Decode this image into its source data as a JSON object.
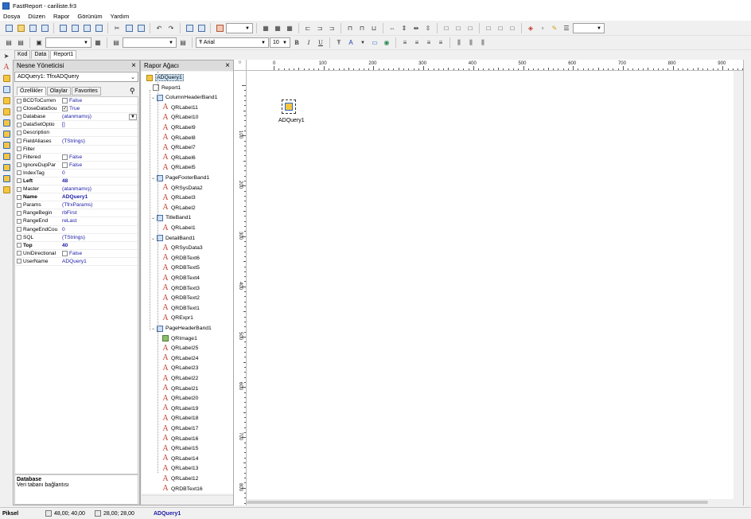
{
  "window": {
    "title": "FastReport - cariliste.fr3"
  },
  "menu": [
    "Dosya",
    "Düzen",
    "Rapor",
    "Görünüm",
    "Yardım"
  ],
  "font_toolbar": {
    "font_name": "Arial",
    "font_size": "10",
    "bold": "B",
    "italic": "I",
    "underline": "U"
  },
  "top_tabs": [
    "Kod",
    "Data",
    "Report1"
  ],
  "object_inspector": {
    "title": "Nesne Yöneticisi",
    "selected": "ADQuery1: TfrxADQuery",
    "tabs": [
      "Özellikler",
      "Olaylar",
      "Favorites"
    ],
    "properties": [
      {
        "name": "BCDToCurren",
        "value": "False",
        "check": true,
        "checked": false,
        "bold": false
      },
      {
        "name": "CloseDataSou",
        "value": "True",
        "check": true,
        "checked": true,
        "bold": false
      },
      {
        "name": "Database",
        "value": "(atanmamış)",
        "check": false,
        "dropdown": true,
        "bold": false
      },
      {
        "name": "DataSetOptio",
        "value": "[]",
        "check": false,
        "bold": false
      },
      {
        "name": "Description",
        "value": "",
        "check": false,
        "bold": false
      },
      {
        "name": "FieldAliases",
        "value": "(TStrings)",
        "check": false,
        "bold": false
      },
      {
        "name": "Filter",
        "value": "",
        "check": false,
        "bold": false
      },
      {
        "name": "Filtered",
        "value": "False",
        "check": true,
        "checked": false,
        "bold": false
      },
      {
        "name": "IgnoreDupPar",
        "value": "False",
        "check": true,
        "checked": false,
        "bold": false
      },
      {
        "name": "IndexTag",
        "value": "0",
        "check": false,
        "bold": false
      },
      {
        "name": "Left",
        "value": "48",
        "check": false,
        "bold": true
      },
      {
        "name": "Master",
        "value": "(atanmamış)",
        "check": false,
        "bold": false
      },
      {
        "name": "Name",
        "value": "ADQuery1",
        "check": false,
        "bold": true
      },
      {
        "name": "Params",
        "value": "(TfrxParams)",
        "check": false,
        "bold": false
      },
      {
        "name": "RangeBegin",
        "value": "rbFirst",
        "check": false,
        "bold": false
      },
      {
        "name": "RangeEnd",
        "value": "reLast",
        "check": false,
        "bold": false
      },
      {
        "name": "RangeEndCou",
        "value": "0",
        "check": false,
        "bold": false
      },
      {
        "name": "SQL",
        "value": "(TStrings)",
        "check": false,
        "bold": false
      },
      {
        "name": "Top",
        "value": "40",
        "check": false,
        "bold": true
      },
      {
        "name": "UniDirectional",
        "value": "False",
        "check": true,
        "checked": false,
        "bold": false
      },
      {
        "name": "UserName",
        "value": "ADQuery1",
        "check": false,
        "bold": false
      }
    ],
    "description_title": "Database",
    "description_text": "Veri tabanı bağlantısı"
  },
  "report_tree": {
    "title": "Rapor Ağacı",
    "nodes": [
      {
        "label": "ADQuery1",
        "level": 1,
        "icon": "db",
        "selected": true
      },
      {
        "label": "Report1",
        "level": 0,
        "icon": "rep"
      },
      {
        "label": "ColumnHeaderBand1",
        "level": 1,
        "icon": "band",
        "expander": true
      },
      {
        "label": "QRLabel11",
        "level": 2,
        "icon": "A"
      },
      {
        "label": "QRLabel10",
        "level": 2,
        "icon": "A"
      },
      {
        "label": "QRLabel9",
        "level": 2,
        "icon": "A"
      },
      {
        "label": "QRLabel8",
        "level": 2,
        "icon": "A"
      },
      {
        "label": "QRLabel7",
        "level": 2,
        "icon": "A"
      },
      {
        "label": "QRLabel6",
        "level": 2,
        "icon": "A"
      },
      {
        "label": "QRLabel5",
        "level": 2,
        "icon": "A"
      },
      {
        "label": "PageFooterBand1",
        "level": 1,
        "icon": "band",
        "expander": true
      },
      {
        "label": "QRSysData2",
        "level": 2,
        "icon": "A"
      },
      {
        "label": "QRLabel3",
        "level": 2,
        "icon": "A"
      },
      {
        "label": "QRLabel2",
        "level": 2,
        "icon": "A"
      },
      {
        "label": "TitleBand1",
        "level": 1,
        "icon": "band",
        "expander": true
      },
      {
        "label": "QRLabel1",
        "level": 2,
        "icon": "A"
      },
      {
        "label": "DetailBand1",
        "level": 1,
        "icon": "band",
        "expander": true
      },
      {
        "label": "QRSysData3",
        "level": 2,
        "icon": "A"
      },
      {
        "label": "QRDBText6",
        "level": 2,
        "icon": "A"
      },
      {
        "label": "QRDBText5",
        "level": 2,
        "icon": "A"
      },
      {
        "label": "QRDBText4",
        "level": 2,
        "icon": "A"
      },
      {
        "label": "QRDBText3",
        "level": 2,
        "icon": "A"
      },
      {
        "label": "QRDBText2",
        "level": 2,
        "icon": "A"
      },
      {
        "label": "QRDBText1",
        "level": 2,
        "icon": "A"
      },
      {
        "label": "QRExpr1",
        "level": 2,
        "icon": "A"
      },
      {
        "label": "PageHeaderBand1",
        "level": 1,
        "icon": "band",
        "expander": true
      },
      {
        "label": "QRImage1",
        "level": 2,
        "icon": "img"
      },
      {
        "label": "QRLabel25",
        "level": 2,
        "icon": "A"
      },
      {
        "label": "QRLabel24",
        "level": 2,
        "icon": "A"
      },
      {
        "label": "QRLabel23",
        "level": 2,
        "icon": "A"
      },
      {
        "label": "QRLabel22",
        "level": 2,
        "icon": "A"
      },
      {
        "label": "QRLabel21",
        "level": 2,
        "icon": "A"
      },
      {
        "label": "QRLabel20",
        "level": 2,
        "icon": "A"
      },
      {
        "label": "QRLabel19",
        "level": 2,
        "icon": "A"
      },
      {
        "label": "QRLabel18",
        "level": 2,
        "icon": "A"
      },
      {
        "label": "QRLabel17",
        "level": 2,
        "icon": "A"
      },
      {
        "label": "QRLabel16",
        "level": 2,
        "icon": "A"
      },
      {
        "label": "QRLabel15",
        "level": 2,
        "icon": "A"
      },
      {
        "label": "QRLabel14",
        "level": 2,
        "icon": "A"
      },
      {
        "label": "QRLabel13",
        "level": 2,
        "icon": "A"
      },
      {
        "label": "QRLabel12",
        "level": 2,
        "icon": "A"
      },
      {
        "label": "QRDBText16",
        "level": 2,
        "icon": "A"
      }
    ]
  },
  "rulers": {
    "horizontal": [
      "0",
      "100",
      "200",
      "300",
      "400",
      "500",
      "600",
      "700",
      "800",
      "900"
    ],
    "vertical": [
      "0",
      "100",
      "200",
      "300",
      "400",
      "500",
      "600",
      "700",
      "800"
    ]
  },
  "canvas": {
    "component_label": "ADQuery1"
  },
  "status": {
    "units": "Piksel",
    "position": "48,00; 40,00",
    "size": "28,00; 28,00",
    "selected": "ADQuery1"
  }
}
